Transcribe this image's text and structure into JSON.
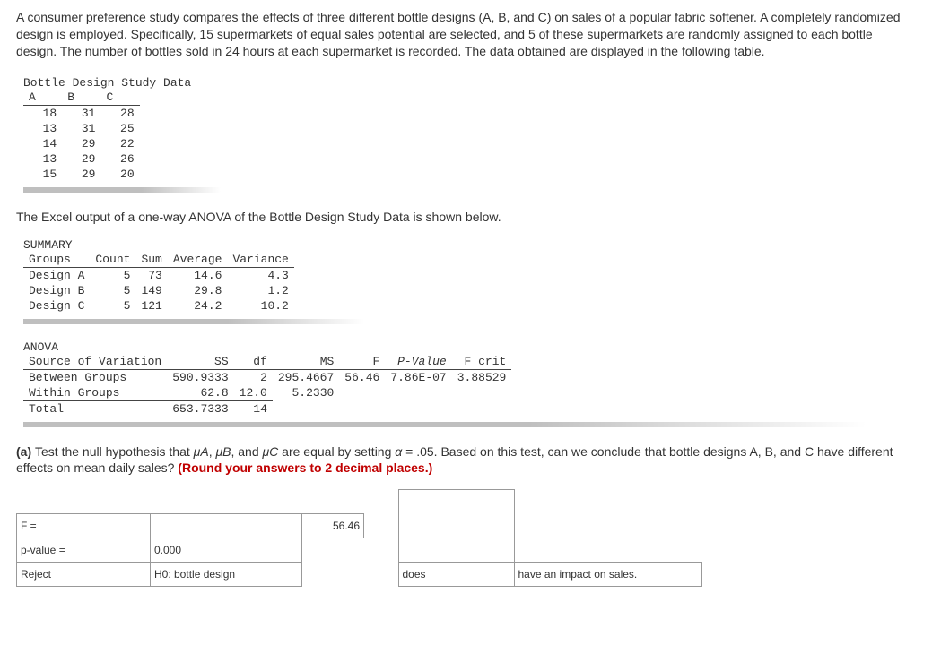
{
  "intro": "A consumer preference study compares the effects of three different bottle designs (A, B, and C) on sales of a popular fabric softener. A completely randomized design is employed. Specifically, 15 supermarkets of equal sales potential are selected, and 5 of these supermarkets are randomly assigned to each bottle design. The number of bottles sold in 24 hours at each supermarket is recorded. The data obtained are displayed in the following table.",
  "data_table": {
    "title": "Bottle Design Study Data",
    "cols": [
      "A",
      "B",
      "C"
    ],
    "rows": [
      [
        "  18",
        "  31",
        "  28"
      ],
      [
        "  13",
        "  31",
        "  25"
      ],
      [
        "  14",
        "  29",
        "  22"
      ],
      [
        "  13",
        "  29",
        "  26"
      ],
      [
        "  15",
        "  29",
        "  20"
      ]
    ]
  },
  "anova_intro": "The Excel output of a one-way ANOVA of the Bottle Design Study Data is shown below.",
  "summary": {
    "title": "SUMMARY",
    "cols": [
      "Groups",
      "Count",
      "Sum",
      "Average",
      "Variance"
    ],
    "rows": [
      [
        "Design A",
        "5",
        " 73",
        "14.6",
        " 4.3"
      ],
      [
        "Design B",
        "5",
        "149",
        "29.8",
        " 1.2"
      ],
      [
        "Design C",
        "5",
        "121",
        "24.2",
        "10.2"
      ]
    ]
  },
  "anova": {
    "title": "ANOVA",
    "cols": [
      "Source of Variation",
      "SS",
      "df",
      "MS",
      "F",
      "P-Value",
      "F crit"
    ],
    "rows": [
      [
        "Between Groups",
        "590.9333",
        "  2",
        "295.4667",
        "56.46",
        "7.86E-07",
        "3.88529"
      ],
      [
        "Within Groups",
        "62.8",
        "12.0",
        "5.2330",
        "",
        "",
        ""
      ]
    ],
    "total": [
      "Total",
      "653.7333",
      " 14",
      "",
      "",
      "",
      ""
    ]
  },
  "partA": {
    "labelPrefix": "(a) ",
    "text1": "Test the null hypothesis that ",
    "muA": "μA",
    "sep": ", ",
    "muB": "μB",
    "sep2": ", and ",
    "muC": "μC",
    "text2": " are equal by setting ",
    "alpha": "α",
    "text3": " = .05. Based on this test, can we conclude that bottle designs A, B, and C have different effects on mean daily sales? ",
    "roundNote": "(Round your answers to 2 decimal places.)"
  },
  "answers": {
    "Flabel": "F =",
    "Fval": "56.46",
    "pLabel": "p-value =",
    "pVal": "0.000",
    "decision": "Reject",
    "h0": "H0: bottle design",
    "does": "does",
    "impact": "have an impact on sales."
  }
}
